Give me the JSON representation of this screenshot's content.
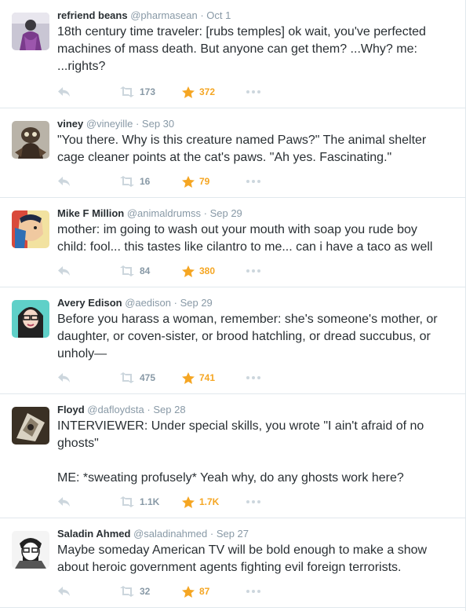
{
  "colors": {
    "name": "#292f33",
    "meta": "#8899a6",
    "icon": "#ccd6dd",
    "favorite": "#f5a623",
    "divider": "#e1e8ed"
  },
  "tweets": [
    {
      "fullname": "refriend beans",
      "screenname": "@pharmasean",
      "dot": "·",
      "time": "Oct 1",
      "text": [
        "18th century time traveler: [rubs temples] ok wait, you've perfected machines of mass death. But anyone can get them? ...Why? me: ...rights?"
      ],
      "retweets": "173",
      "favorites": "372",
      "avatar_icon": "avatar-icon"
    },
    {
      "fullname": "viney",
      "screenname": "@vineyille",
      "dot": "·",
      "time": "Sep 30",
      "text": [
        "\"You there. Why is this creature named Paws?\" The animal shelter cage cleaner points at the cat's paws. \"Ah yes. Fascinating.\""
      ],
      "retweets": "16",
      "favorites": "79",
      "avatar_icon": "avatar-icon"
    },
    {
      "fullname": "Mike F Million",
      "screenname": "@animaldrumss",
      "dot": "·",
      "time": "Sep 29",
      "text": [
        "mother: im going to wash out your mouth with soap you rude boy child: fool... this tastes like cilantro to me... can i have a taco as well"
      ],
      "retweets": "84",
      "favorites": "380",
      "avatar_icon": "avatar-icon"
    },
    {
      "fullname": "Avery Edison",
      "screenname": "@aedison",
      "dot": "·",
      "time": "Sep 29",
      "text": [
        "Before you harass a woman, remember: she's someone's mother, or daughter, or coven-sister, or brood hatchling, or dread succubus, or unholy—"
      ],
      "retweets": "475",
      "favorites": "741",
      "avatar_icon": "avatar-icon"
    },
    {
      "fullname": "Floyd",
      "screenname": "@dafloydsta",
      "dot": "·",
      "time": "Sep 28",
      "text": [
        "INTERVIEWER: Under special skills, you wrote \"I ain't afraid of no ghosts\"",
        "ME: *sweating profusely* Yeah why, do any ghosts work here?"
      ],
      "retweets": "1.1K",
      "favorites": "1.7K",
      "avatar_icon": "avatar-icon"
    },
    {
      "fullname": "Saladin Ahmed",
      "screenname": "@saladinahmed",
      "dot": "·",
      "time": "Sep 27",
      "text": [
        "Maybe someday American TV will be bold enough to make a show about heroic government agents fighting evil foreign terrorists."
      ],
      "retweets": "32",
      "favorites": "87",
      "avatar_icon": "avatar-icon"
    }
  ]
}
